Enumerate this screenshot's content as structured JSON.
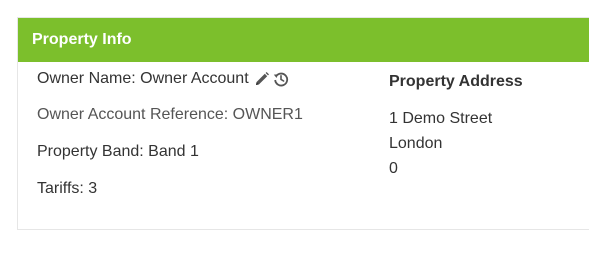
{
  "panel": {
    "title": "Property Info",
    "header_color": "#7cbf2c"
  },
  "fields": {
    "owner_name": {
      "label": "Owner Name",
      "value": "Owner Account"
    },
    "owner_reference": {
      "label": "Owner Account Reference",
      "value": "OWNER1"
    },
    "property_band": {
      "label": "Property Band",
      "value": "Band 1"
    },
    "tariffs": {
      "label": "Tariffs",
      "value": "3"
    }
  },
  "icons": {
    "edit": "pencil-icon",
    "history": "history-icon"
  },
  "address": {
    "title": "Property Address",
    "lines": [
      "1 Demo Street",
      "London",
      "0"
    ]
  }
}
